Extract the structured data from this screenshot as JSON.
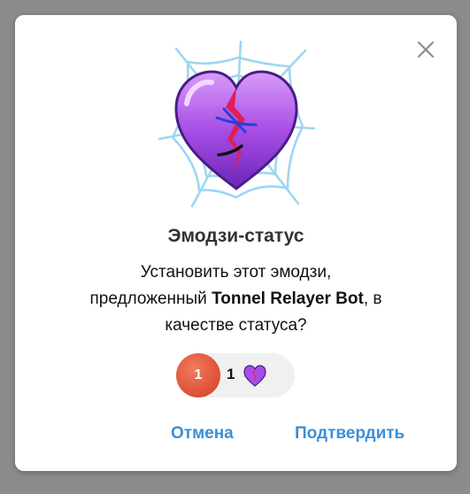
{
  "dialog": {
    "title": "Эмодзи-статус",
    "message_line1": "Установить этот эмодзи,",
    "message_prefix": "предложенный ",
    "bot_name": "Tonnel Relayer Bot",
    "message_suffix": ", в",
    "message_line3": "качестве статуса?",
    "reaction": {
      "badge_number": "1",
      "count": "1",
      "icon": "purple-heart-icon"
    },
    "cancel_label": "Отмена",
    "confirm_label": "Подтвердить",
    "close_icon": "close-icon",
    "emoji_icon": "broken-purple-heart-spiderweb-icon"
  },
  "colors": {
    "accent": "#3b8fd6",
    "badge": "#e0553b",
    "heart": "#a34ae0",
    "web": "#9ed6f2"
  }
}
